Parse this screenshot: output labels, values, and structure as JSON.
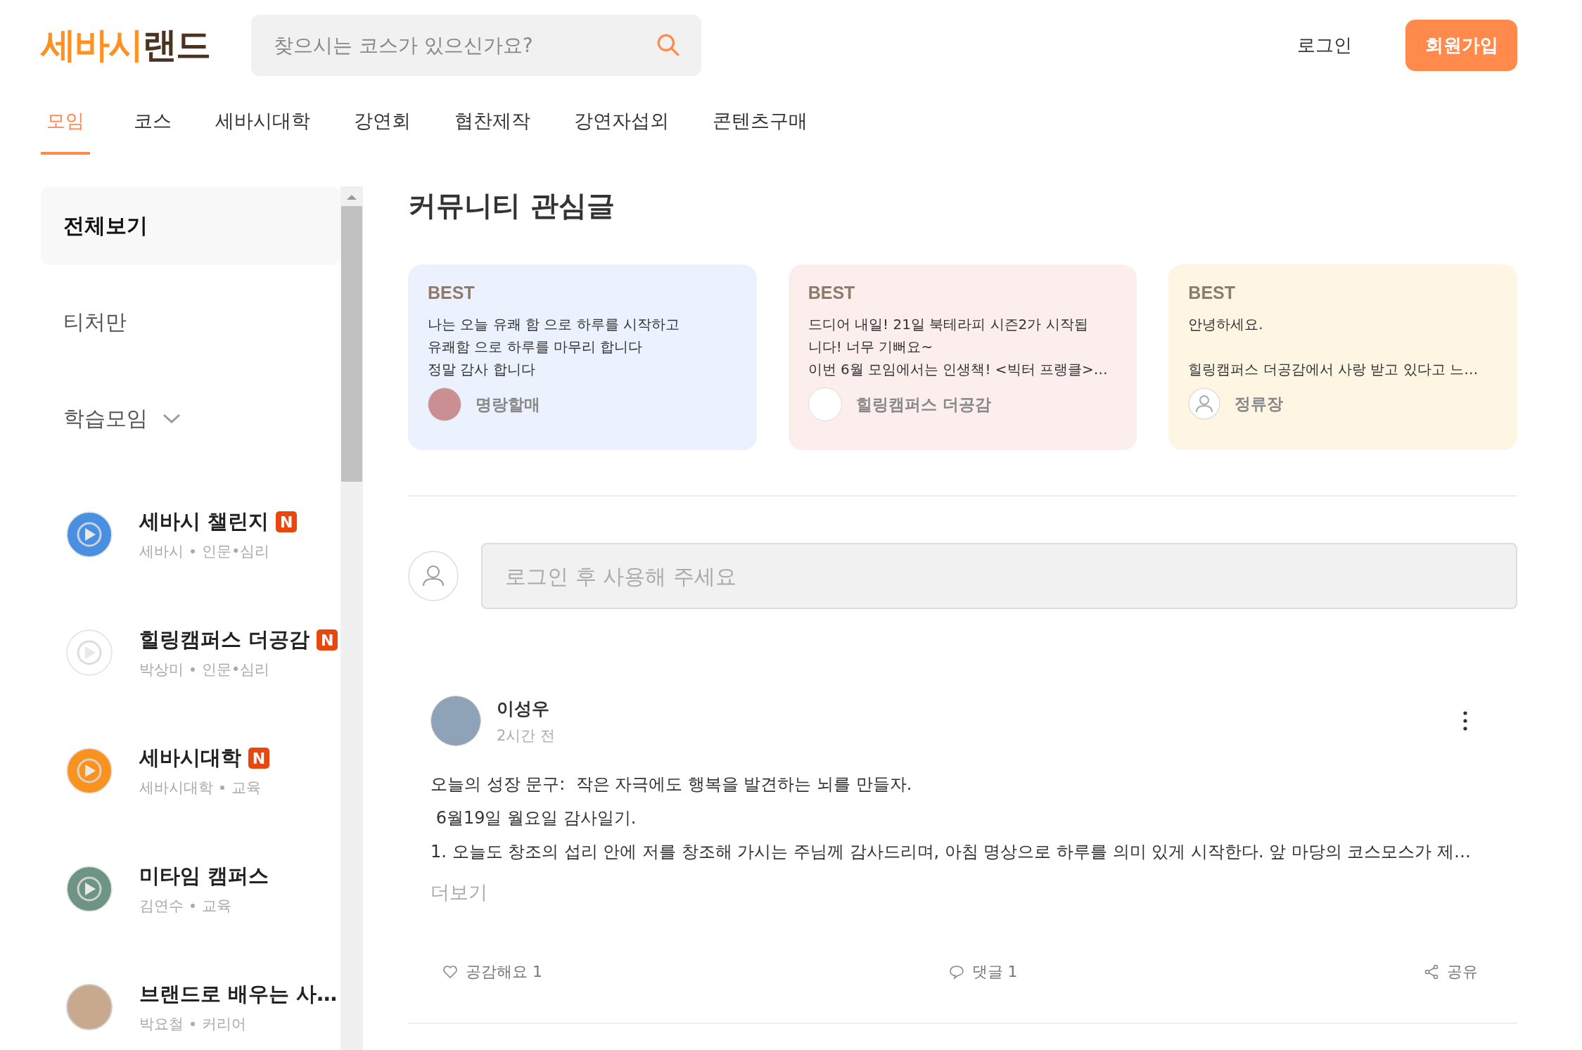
{
  "logo": {
    "accent": "세바시",
    "rest": "랜드"
  },
  "search": {
    "placeholder": "찾으시는 코스가 있으신가요?"
  },
  "auth": {
    "login": "로그인",
    "signup": "회원가입"
  },
  "tabs": [
    {
      "label": "모임",
      "selected": true
    },
    {
      "label": "코스",
      "selected": false
    },
    {
      "label": "세바시대학",
      "selected": false
    },
    {
      "label": "강연회",
      "selected": false
    },
    {
      "label": "협찬제작",
      "selected": false
    },
    {
      "label": "강연자섭외",
      "selected": false
    },
    {
      "label": "콘텐츠구매",
      "selected": false
    }
  ],
  "sidebar": {
    "filters": [
      {
        "label": "전체보기",
        "selected": true,
        "kind": "plain"
      },
      {
        "label": "티처만",
        "selected": false,
        "kind": "plain"
      },
      {
        "label": "학습모임",
        "selected": false,
        "kind": "dropdown"
      }
    ],
    "groups": [
      {
        "name": "세바시 챌린지",
        "badge": "N",
        "owner": "세바시",
        "category": "인문•심리",
        "avatar": {
          "kind": "logo",
          "color": "#4a90e2"
        }
      },
      {
        "name": "힐링캠퍼스 더공감",
        "badge": "N",
        "owner": "박상미",
        "category": "인문•심리",
        "avatar": {
          "kind": "logo",
          "color": "#ffffff"
        }
      },
      {
        "name": "세바시대학",
        "badge": "N",
        "owner": "세바시대학",
        "category": "교육",
        "avatar": {
          "kind": "logo",
          "color": "#f7931e"
        }
      },
      {
        "name": "미타임 캠퍼스",
        "owner": "김연수",
        "category": "교육",
        "avatar": {
          "kind": "logo",
          "color": "#6e9484"
        }
      },
      {
        "name": "브랜드로 배우는 사…",
        "owner": "박요철",
        "category": "커리어",
        "avatar": {
          "kind": "photo",
          "color": "#c9a98e"
        }
      }
    ]
  },
  "community": {
    "title": "커뮤니티 관심글",
    "cards": [
      {
        "label": "BEST",
        "lines": [
          "나는 오늘 유쾌  함 으로 하루를 시작하고",
          "유쾌함 으로 하루를 마무리 합니다",
          "정말 감사 합니다"
        ],
        "author": "명랑할매",
        "avatar": {
          "kind": "photo"
        },
        "color": "#ebf2fd"
      },
      {
        "label": "BEST",
        "lines": [
          "드디어 내일! 21일 북테라피 시즌2가 시작됩",
          "니다! 너무 기뻐요~",
          "이번 6월 모임에서는 인생책! <빅터 프랭클>…"
        ],
        "author": "힐링캠퍼스 더공감",
        "avatar": {
          "kind": "logo"
        },
        "color": "#fdeeee"
      },
      {
        "label": "BEST",
        "lines": [
          "안녕하세요.",
          "힐링캠퍼스 더공감에서 사랑 받고 있다고 느…"
        ],
        "author": "정류장",
        "avatar": {
          "kind": "default"
        },
        "color": "#fff5e3"
      }
    ]
  },
  "comment": {
    "placeholder": "로그인 후 사용해 주세요"
  },
  "post": {
    "author": "이성우",
    "time": "2시간 전",
    "lines": [
      "오늘의 성장 문구:  작은 자극에도 행복을 발견하는 뇌를 만들자.",
      " 6월19일 월요일 감사일기.",
      "1. 오늘도 창조의 섭리 안에 저를 창조해 가시는 주님께 감사드리며, 아침 명상으로 하루를 의미 있게 시작한다. 앞 마당의 코스모스가 제…"
    ],
    "more": "더보기",
    "like": "공감해요 1",
    "comments": "댓글 1",
    "share": "공유"
  }
}
